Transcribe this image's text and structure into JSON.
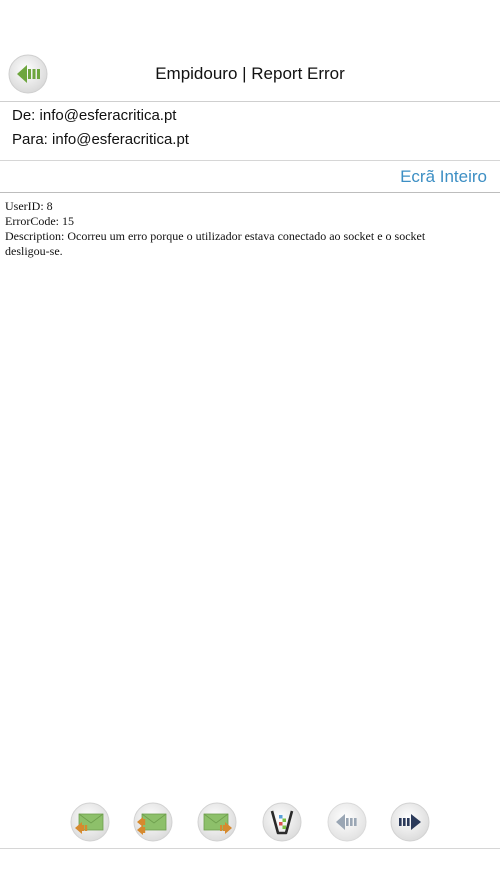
{
  "header": {
    "title": "Empidouro | Report Error",
    "back_icon": "back-arrow-icon"
  },
  "message": {
    "from_label": "De:",
    "from_value": "info@esferacritica.pt",
    "to_label": "Para:",
    "to_value": "info@esferacritica.pt",
    "fullscreen_label": "Ecrã Inteiro",
    "body_lines": [
      "UserID: 8",
      "ErrorCode: 15",
      "Description: Ocorreu um erro porque o utilizador estava conectado ao socket e o socket",
      "desligou-se."
    ]
  },
  "toolbar": {
    "buttons": [
      {
        "icon": "reply-mail-icon"
      },
      {
        "icon": "reply-all-mail-icon"
      },
      {
        "icon": "forward-mail-icon"
      },
      {
        "icon": "delete-trash-icon"
      },
      {
        "icon": "previous-arrow-icon"
      },
      {
        "icon": "next-arrow-icon"
      }
    ]
  },
  "colors": {
    "accent": "#3d8fc4",
    "back_green": "#7bb04a",
    "next_dark": "#2b3a5a"
  }
}
